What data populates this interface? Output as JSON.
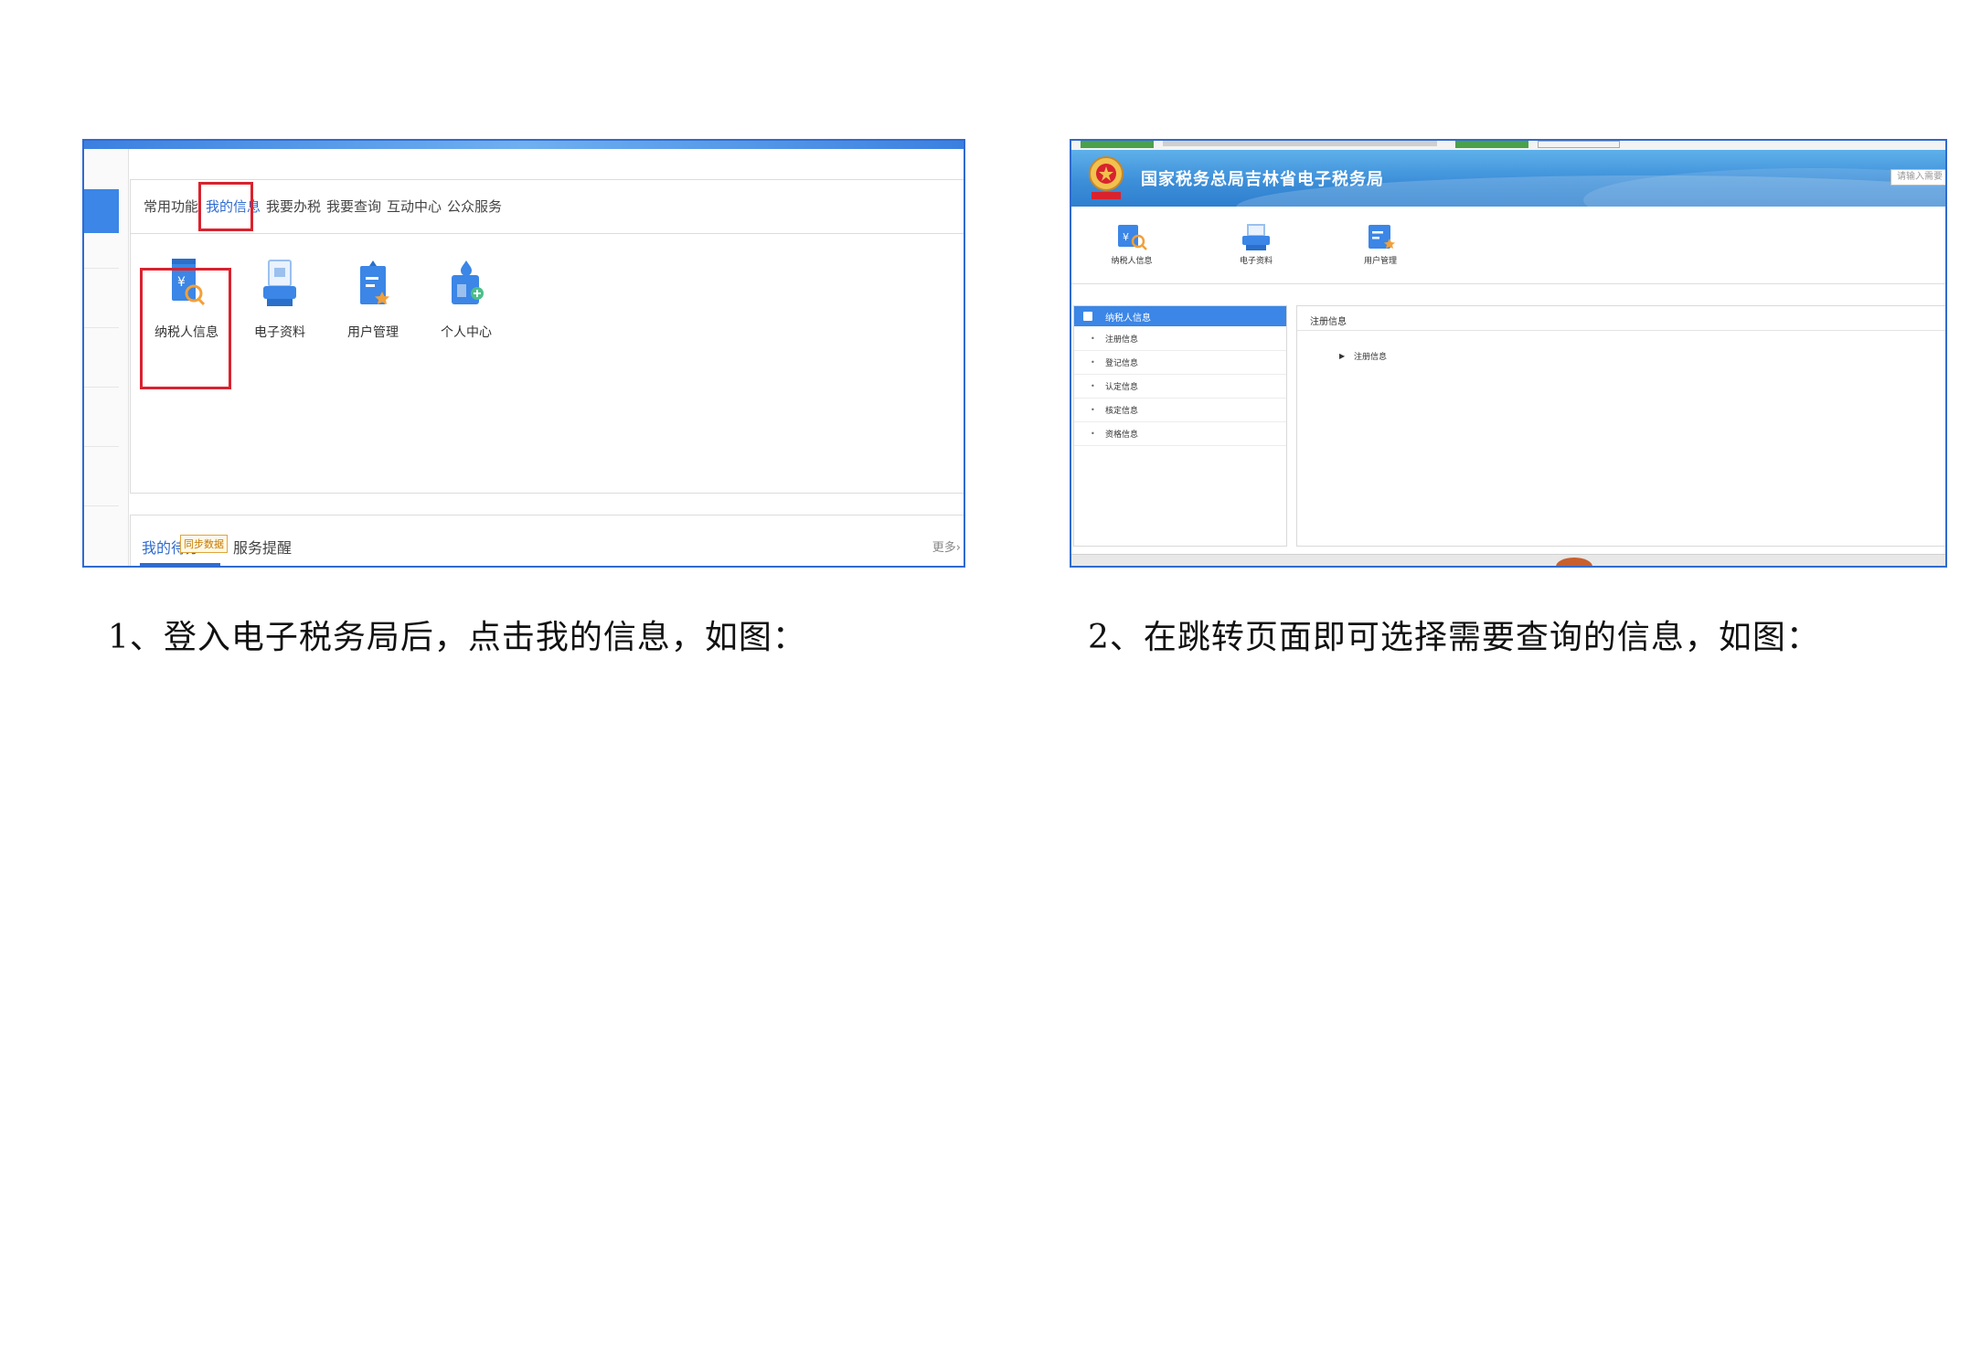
{
  "colors": {
    "accent": "#2f6bd0",
    "highlight_box": "#d8232f",
    "banner_blue": "#3d8fd9"
  },
  "shot1": {
    "tabs": [
      "常用功能",
      "我的信息",
      "我要办税",
      "我要查询",
      "互动中心",
      "公众服务"
    ],
    "active_tab": "我的信息",
    "apps": [
      {
        "label": "纳税人信息",
        "icon": "taxpayer-info-icon"
      },
      {
        "label": "电子资料",
        "icon": "electronic-docs-icon"
      },
      {
        "label": "用户管理",
        "icon": "user-management-icon"
      },
      {
        "label": "个人中心",
        "icon": "personal-center-icon"
      }
    ],
    "bottom_tabs": {
      "todo": "我的待办",
      "badge": "同步数据",
      "remind": "服务提醒",
      "more": "更多›"
    }
  },
  "shot2": {
    "site_title": "国家税务总局吉林省电子税务局",
    "search_placeholder": "请输入需要",
    "apps": [
      {
        "label": "纳税人信息",
        "icon": "taxpayer-info-icon"
      },
      {
        "label": "电子资料",
        "icon": "electronic-docs-icon"
      },
      {
        "label": "用户管理",
        "icon": "user-management-icon"
      }
    ],
    "sidebar": {
      "title": "纳税人信息",
      "items": [
        "注册信息",
        "登记信息",
        "认定信息",
        "核定信息",
        "资格信息"
      ]
    },
    "main": {
      "title": "注册信息",
      "tree_node": "注册信息"
    }
  },
  "captions": [
    "1、登入电子税务局后，点击我的信息，如图：",
    "2、在跳转页面即可选择需要查询的信息，如图："
  ]
}
